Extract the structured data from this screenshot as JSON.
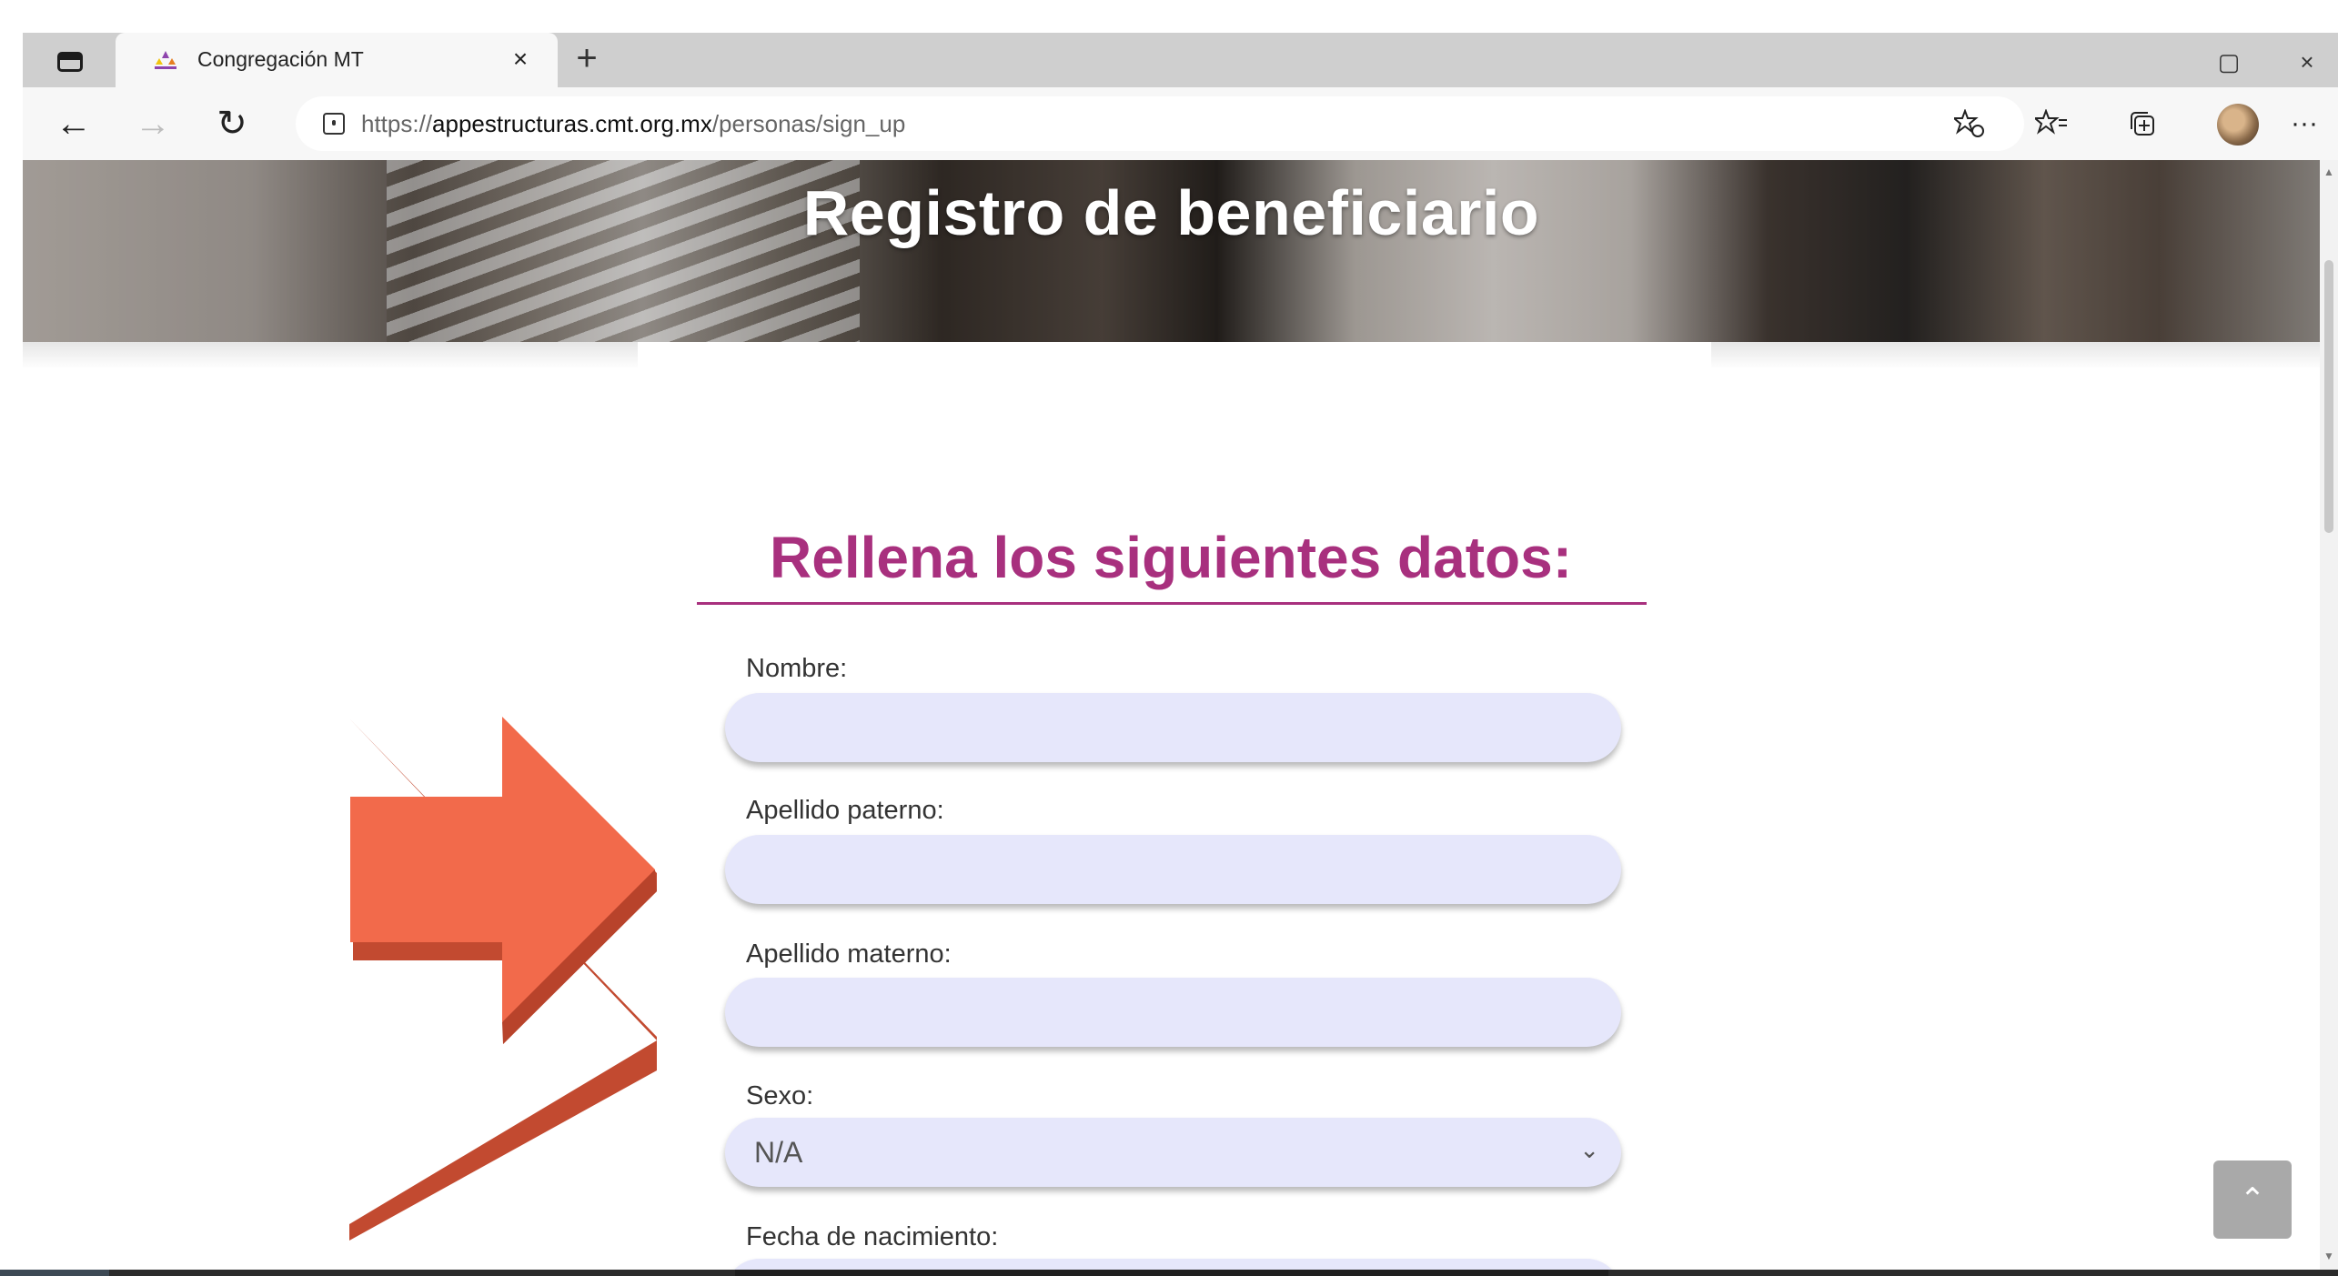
{
  "browser": {
    "tab": {
      "title": "Congregación MT",
      "close_glyph": "×"
    },
    "new_tab_glyph": "+",
    "window": {
      "restore_glyph": "▢",
      "close_glyph": "×"
    },
    "nav": {
      "back_glyph": "←",
      "forward_glyph": "→",
      "refresh_glyph": "↻"
    },
    "url": {
      "scheme": "https://",
      "host": "appestructuras.cmt.org.mx",
      "path": "/personas/sign_up"
    },
    "toolbar": {
      "more_glyph": "···"
    }
  },
  "hero": {
    "title": "Registro de beneficiario"
  },
  "form": {
    "title": "Rellena los siguientes datos:",
    "fields": [
      {
        "label": "Nombre:",
        "value": ""
      },
      {
        "label": "Apellido paterno:",
        "value": ""
      },
      {
        "label": "Apellido materno:",
        "value": ""
      },
      {
        "label": "Sexo:",
        "value": "N/A"
      },
      {
        "label": "Fecha de nacimiento:",
        "value": ""
      }
    ]
  },
  "scroll_top": {
    "glyph": "⌃"
  },
  "colors": {
    "accent": "#a8307e",
    "input_bg": "#e6e7fb",
    "arrow": "#f26a4b",
    "arrow_side": "#c24a30"
  },
  "icons": {
    "tab_favicon": "congregation-logo-icon",
    "sidebar": "tab-sidebar-icon",
    "lock": "site-info-icon",
    "read_aloud": "read-aloud-icon",
    "favorites": "favorites-icon",
    "collections": "collections-icon",
    "profile": "avatar",
    "pointer": "orange-arrow-icon"
  }
}
